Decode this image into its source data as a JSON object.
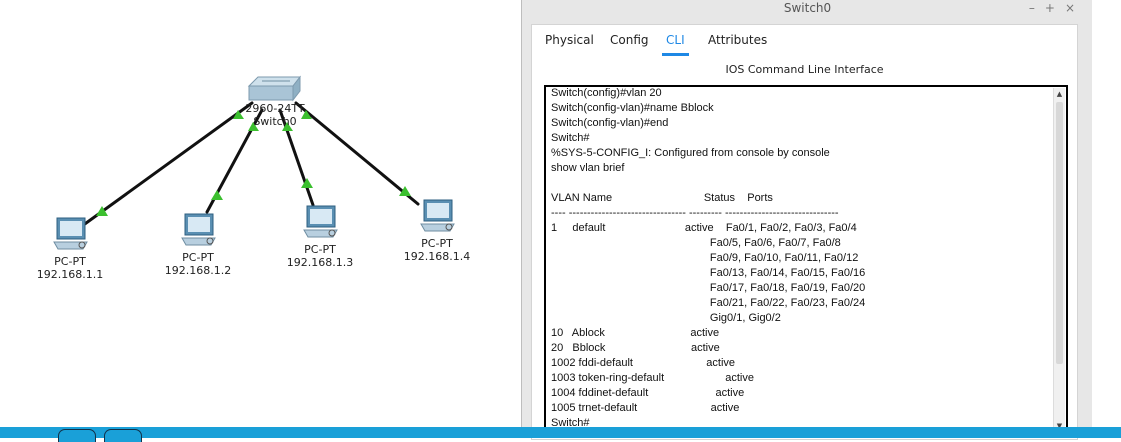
{
  "window": {
    "title": "Switch0",
    "controls": [
      "–",
      "+",
      "×"
    ]
  },
  "tabs": [
    {
      "label": "Physical",
      "active": false
    },
    {
      "label": "Config",
      "active": false
    },
    {
      "label": "CLI",
      "active": true
    },
    {
      "label": "Attributes",
      "active": false
    }
  ],
  "cli": {
    "header": "IOS Command Line Interface",
    "lines": [
      "Switch(config)#vlan 20",
      "Switch(config-vlan)#name Bblock",
      "Switch(config-vlan)#end",
      "Switch#",
      "%SYS-5-CONFIG_I: Configured from console by console",
      "show vlan brief",
      "",
      "VLAN Name                              Status    Ports",
      "---- -------------------------------- --------- -------------------------------",
      "1     default                          active    Fa0/1, Fa0/2, Fa0/3, Fa0/4",
      "                                                    Fa0/5, Fa0/6, Fa0/7, Fa0/8",
      "                                                    Fa0/9, Fa0/10, Fa0/11, Fa0/12",
      "                                                    Fa0/13, Fa0/14, Fa0/15, Fa0/16",
      "                                                    Fa0/17, Fa0/18, Fa0/19, Fa0/20",
      "                                                    Fa0/21, Fa0/22, Fa0/23, Fa0/24",
      "                                                    Gig0/1, Gig0/2",
      "10   Ablock                            active",
      "20   Bblock                            active",
      "1002 fddi-default                        active",
      "1003 token-ring-default                    active",
      "1004 fddinet-default                      active",
      "1005 trnet-default                        active",
      "Switch#"
    ]
  },
  "topology": {
    "switch": {
      "model": "2960-24TT",
      "name": "Switch0"
    },
    "pcs": [
      {
        "type": "PC-PT",
        "ip": "192.168.1.1"
      },
      {
        "type": "PC-PT",
        "ip": "192.168.1.2"
      },
      {
        "type": "PC-PT",
        "ip": "192.168.1.3"
      },
      {
        "type": "PC-PT",
        "ip": "192.168.1.4"
      }
    ],
    "link_status_color": "#3bbf2e"
  },
  "colors": {
    "accent": "#1e88e5",
    "taskbar": "#1aa0d8"
  }
}
